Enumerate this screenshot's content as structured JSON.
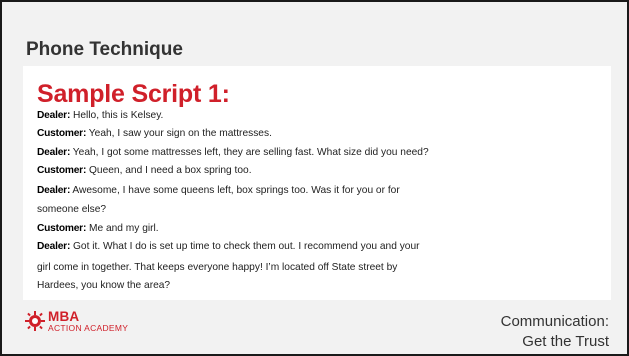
{
  "title": "Phone Technique",
  "heading": "Sample Script 1:",
  "script": [
    {
      "speaker": "Dealer:",
      "text": " Hello, this is Kelsey."
    },
    {
      "speaker": "Customer:",
      "text": " Yeah, I saw your sign on the mattresses."
    },
    {
      "speaker": "Dealer:",
      "text": " Yeah, I got some mattresses left, they are selling fast. What size did you need?"
    },
    {
      "speaker": "Customer:",
      "text": " Queen, and I need a box spring too."
    },
    {
      "speaker": "Dealer:",
      "text": " Awesome, I have some queens left, box springs too. Was it for you or for"
    },
    {
      "speaker": "",
      "text": "someone else?"
    },
    {
      "speaker": "Customer:",
      "text": " Me and my girl."
    },
    {
      "speaker": "Dealer:",
      "text": " Got it. What I do is set up time to check them out. I recommend you and your"
    },
    {
      "speaker": "",
      "text": "girl come in together. That keeps everyone happy! I’m located off State street by"
    },
    {
      "speaker": "",
      "text": "Hardees, you know the area?"
    }
  ],
  "logo": {
    "name": "MBA",
    "tagline": "ACTION ACADEMY"
  },
  "subtitle": {
    "line1": "Communication:",
    "line2": "Get the Trust"
  },
  "colors": {
    "accent": "#d0202a",
    "background": "#f2f2f2",
    "content_bg": "#ffffff"
  }
}
